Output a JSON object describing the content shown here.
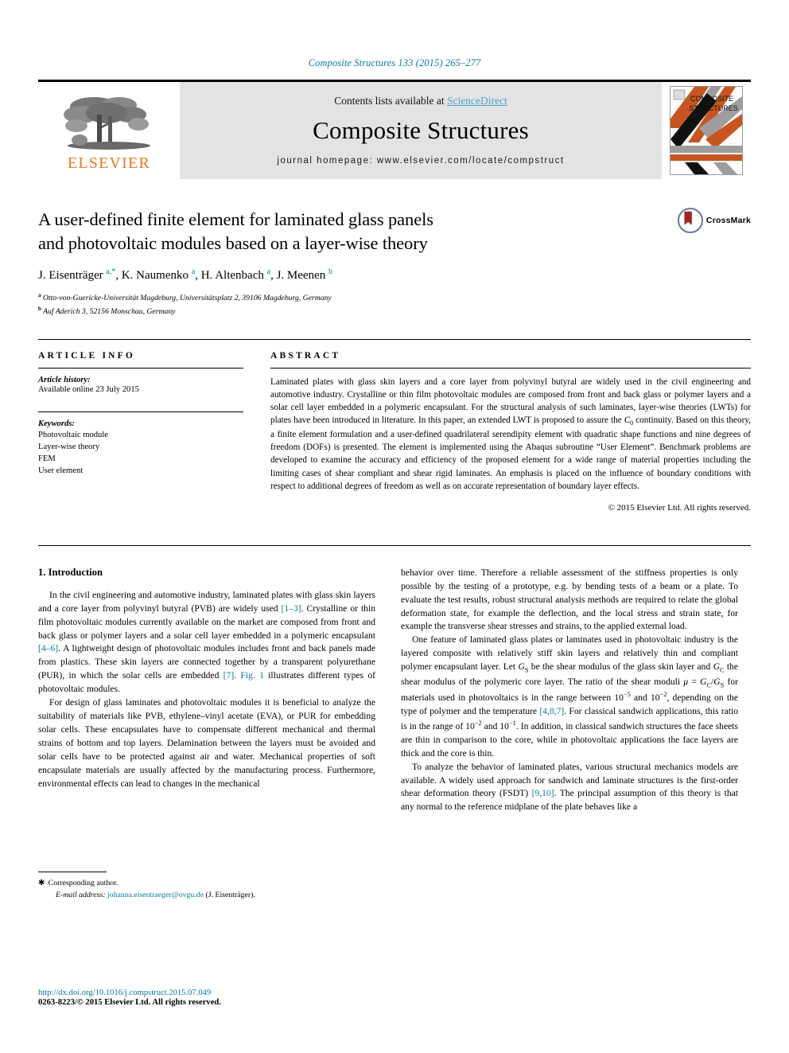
{
  "running_head": "Composite Structures 133 (2015) 265–277",
  "masthead": {
    "contents_prefix": "Contents lists available at ",
    "sciencedirect": "ScienceDirect",
    "journal_title": "Composite Structures",
    "homepage": "journal homepage: www.elsevier.com/locate/compstruct",
    "publisher_wordmark": "ELSEVIER",
    "cover_title_line1": "COMPOSITE",
    "cover_title_line2": "STRUCTURES",
    "publisher_color": "#E87722",
    "link_color": "#4ea3d6"
  },
  "article": {
    "title_line1": "A user-defined finite element for laminated glass panels",
    "title_line2": "and photovoltaic modules based on a layer-wise theory",
    "authors_html": "J. Eisenträger <sup>a,*</sup>, K. Naumenko <sup>a</sup>, H. Altenbach <sup>a</sup>, J. Meenen <sup>b</sup>",
    "affiliation_a": "Otto-von-Guericke-Universität Magdeburg, Universitätsplatz 2, 39106 Magdeburg, Germany",
    "affiliation_b": "Auf Aderich 3, 52156 Monschau, Germany",
    "crossmark_label": "CrossMark"
  },
  "info": {
    "heading": "ARTICLE INFO",
    "history_label": "Article history:",
    "history_value": "Available online 23 July 2015",
    "keywords_label": "Keywords:",
    "keywords": [
      "Photovoltaic module",
      "Layer-wise theory",
      "FEM",
      "User element"
    ]
  },
  "abstract": {
    "heading": "ABSTRACT",
    "paragraph_html": "Laminated plates with glass skin layers and a core layer from polyvinyl butyral are widely used in the civil engineering and automotive industry. Crystalline or thin film photovoltaic modules are composed from front and back glass or polymer layers and a solar cell layer embedded in a polymeric encapsulant. For the structural analysis of such laminates, layer-wise theories (LWTs) for plates have been introduced in literature. In this paper, an extended LWT is proposed to assure the <span class=\"mathvar\">C</span><sub>0</sub> continuity. Based on this theory, a finite element formulation and a user-defined quadrilateral serendipity element with quadratic shape functions and nine degrees of freedom (DOFs) is presented. The element is implemented using the Abaqus subroutine “User Element”. Benchmark problems are developed to examine the accuracy and efficiency of the proposed element for a wide range of material properties including the limiting cases of shear compliant and shear rigid laminates. An emphasis is placed on the influence of boundary conditions with respect to additional degrees of freedom as well as on accurate representation of boundary layer effects.",
    "copyright": "© 2015 Elsevier Ltd. All rights reserved."
  },
  "body": {
    "section_title": "1. Introduction",
    "left_paragraphs_html": [
      "In the civil engineering and automotive industry, laminated plates with glass skin layers and a core layer from polyvinyl butyral (PVB) are widely used <span class=\"ref\">[1–3]</span>. Crystalline or thin film photovoltaic modules currently available on the market are composed from front and back glass or polymer layers and a solar cell layer embedded in a polymeric encapsulant <span class=\"ref\">[4–6]</span>. A lightweight design of photovoltaic modules includes front and back panels made from plastics. These skin layers are connected together by a transparent polyurethane (PUR), in which the solar cells are embedded <span class=\"ref\">[7]</span>. <span class=\"ref\">Fig. 1</span> illustrates different types of photovoltaic modules.",
      "For design of glass laminates and photovoltaic modules it is beneficial to analyze the suitability of materials like PVB, ethylene–vinyl acetate (EVA), or PUR for embedding solar cells. These encapsulates have to compensate different mechanical and thermal strains of bottom and top layers. Delamination between the layers must be avoided and solar cells have to be protected against air and water. Mechanical properties of soft encapsulate materials are usually affected by the manufacturing process. Furthermore, environmental effects can lead to changes in the mechanical"
    ],
    "right_paragraphs_html": [
      "behavior over time. Therefore a reliable assessment of the stiffness properties is only possible by the testing of a prototype, e.g. by bending tests of a beam or a plate. To evaluate the test results, robust structural analysis methods are required to relate the global deformation state, for example the deflection, and the local stress and strain state, for example the transverse shear stresses and strains, to the applied external load.",
      "One feature of laminated glass plates or laminates used in photovoltaic industry is the layered composite with relatively stiff skin layers and relatively thin and compliant polymer encapsulant layer. Let <span class=\"mathvar\">G</span><sub>S</sub> be the shear modulus of the glass skin layer and <span class=\"mathvar\">G</span><sub>C</sub> the shear modulus of the polymeric core layer. The ratio of the shear moduli <span class=\"mathvar\">μ</span> = <span class=\"mathvar\">G</span><sub>C</sub>/<span class=\"mathvar\">G</span><sub>S</sub> for materials used in photovoltaics is in the range between 10<sup>−5</sup> and 10<sup>−2</sup>, depending on the type of polymer and the temperature <span class=\"ref\">[4,8,7]</span>. For classical sandwich applications, this ratio is in the range of 10<sup>−2</sup> and 10<sup>−1</sup>. In addition, in classical sandwich structures the face sheets are thin in comparison to the core, while in photovoltaic applications the face layers are thick and the core is thin.",
      "To analyze the behavior of laminated plates, various structural mechanics models are available. A widely used approach for sandwich and laminate structures is the first-order shear deformation theory (FSDT) <span class=\"ref\">[9,10]</span>. The principal assumption of this theory is that any normal to the reference midplane of the plate behaves like a"
    ]
  },
  "footnote": {
    "corresponding": "Corresponding author.",
    "email_label": "E-mail address:",
    "email": "johanna.eisentraeger@ovgu.de",
    "email_suffix": "(J. Eisenträger)."
  },
  "footer": {
    "doi": "http://dx.doi.org/10.1016/j.compstruct.2015.07.049",
    "issn": "0263-8223/© 2015 Elsevier Ltd. All rights reserved."
  }
}
